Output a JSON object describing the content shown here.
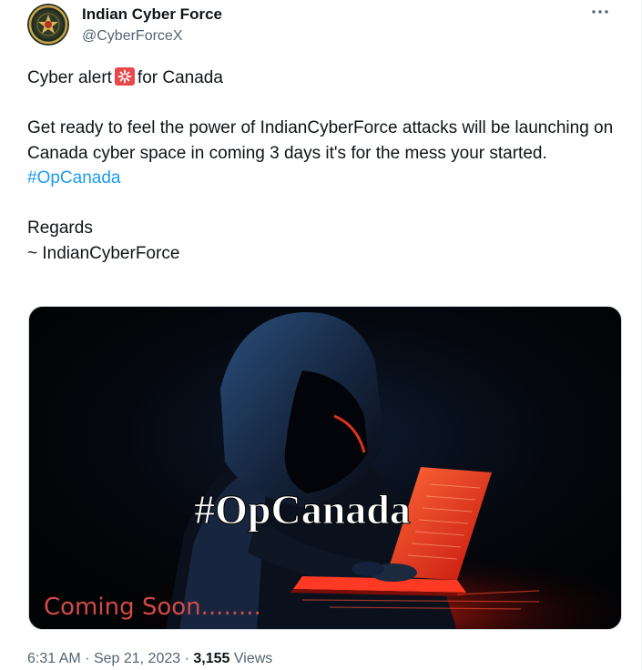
{
  "post": {
    "author": {
      "display_name": "Indian Cyber Force",
      "handle": "@CyberForceX"
    },
    "more_icon": "more-horizontal-icon",
    "text": {
      "line1_before": "Cyber alert",
      "line1_emoji": "siren-icon",
      "line1_after": "for Canada",
      "paragraph": "Get ready to feel the power of IndianCyberForce attacks will be launching on Canada cyber space in coming 3 days it's for the mess your started.",
      "hashtag": "#OpCanada",
      "regards": "Regards",
      "signature": "~ IndianCyberForce"
    },
    "media": {
      "overlay_title": "#OpCanada",
      "overlay_subtitle": "Coming Soon........",
      "accent_color": "#ff2a1a"
    },
    "meta": {
      "time": "6:31 AM",
      "separator": "·",
      "date": "Sep 21, 2023",
      "views_count": "3,155",
      "views_label": "Views"
    }
  }
}
